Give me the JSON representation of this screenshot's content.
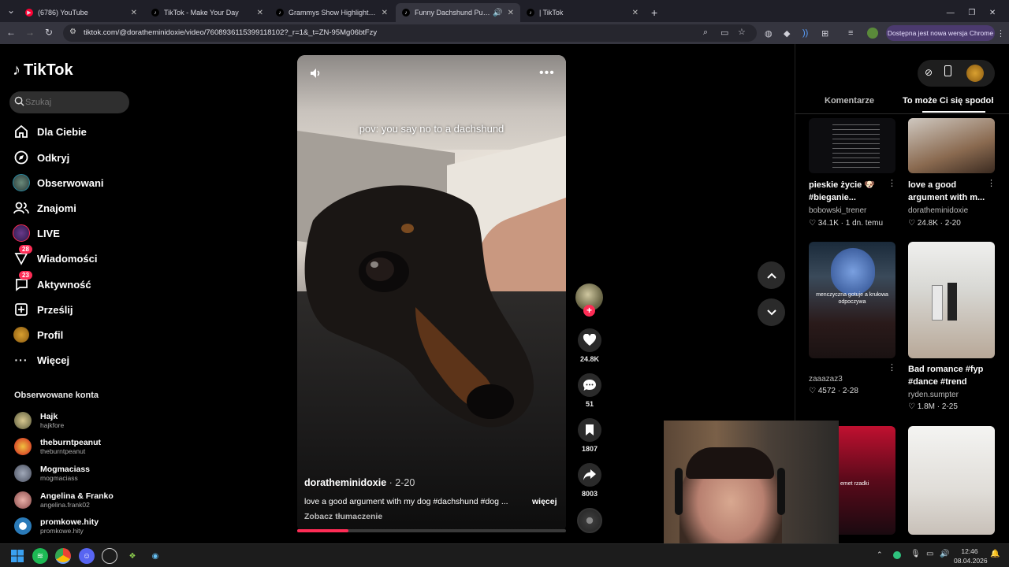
{
  "browser": {
    "tabs": [
      {
        "title": "(6786) YouTube",
        "active": false,
        "favicon": "youtube-icon"
      },
      {
        "title": "TikTok - Make Your Day",
        "active": false,
        "favicon": "tiktok-icon"
      },
      {
        "title": "Grammys Show Highlights | Tik",
        "active": false,
        "favicon": "tiktok-icon"
      },
      {
        "title": "Funny Dachshund Puppy Ar",
        "active": true,
        "favicon": "tiktok-icon"
      },
      {
        "title": "| TikTok",
        "active": false,
        "favicon": "tiktok-icon"
      }
    ],
    "url": "tiktok.com/@doratheminidoxie/video/7608936115399118102?_r=1&_t=ZN-95Mg06btFzy",
    "update_label": "Dostępna jest nowa wersja Chrome"
  },
  "sidebar": {
    "logo": "TikTok",
    "search_placeholder": "Szukaj",
    "items": [
      {
        "label": "Dla Ciebie",
        "icon": "home-icon"
      },
      {
        "label": "Odkryj",
        "icon": "compass-icon"
      },
      {
        "label": "Obserwowani",
        "icon": "avatar-icon"
      },
      {
        "label": "Znajomi",
        "icon": "friends-icon"
      },
      {
        "label": "LIVE",
        "icon": "live-icon"
      },
      {
        "label": "Wiadomości",
        "icon": "messages-icon",
        "badge": "28"
      },
      {
        "label": "Aktywność",
        "icon": "activity-icon",
        "badge": "23"
      },
      {
        "label": "Prześlij",
        "icon": "upload-icon"
      },
      {
        "label": "Profil",
        "icon": "profile-icon"
      },
      {
        "label": "Więcej",
        "icon": "more-icon"
      }
    ],
    "followed_title": "Obserwowane konta",
    "followed": [
      {
        "name": "Hajk",
        "handle": "hajkfore"
      },
      {
        "name": "theburntpeanut",
        "handle": "theburntpeanut"
      },
      {
        "name": "Mogmaciass",
        "handle": "mogmaciass"
      },
      {
        "name": "Angelina & Franko",
        "handle": "angelina.frank02"
      },
      {
        "name": "promkowe.hity",
        "handle": "promkowe.hity"
      }
    ]
  },
  "video": {
    "overlay_text": "pov: you say no to a dachshund",
    "author": "doratheminidoxie",
    "date": "· 2-20",
    "description": "love a good argument with my dog #dachshund #dog ...",
    "more_label": "więcej",
    "translate_label": "Zobacz tłumaczenie",
    "progress_fraction": 0.19
  },
  "actions": {
    "likes": "24.8K",
    "comments": "51",
    "saves": "1807",
    "shares": "8003"
  },
  "right_panel": {
    "tab_comments": "Komentarze",
    "tab_foryou": "To może Ci się spodobać",
    "cards": [
      {
        "title": "pieskie życie 🐶 #bieganie...",
        "user": "bobowski_trener",
        "stats": "♡ 34.1K · 1 dn. temu"
      },
      {
        "title": "love a good argument with m...",
        "user": "doratheminidoxie",
        "stats": "♡ 24.8K · 2-20"
      },
      {
        "title": "",
        "user": "zaaazaz3",
        "stats": "♡ 4572 · 2-28"
      },
      {
        "title": "Bad romance #fyp #dance #trend",
        "user": "ryden.sumpter",
        "stats": "♡ 1.8M · 2-25"
      }
    ],
    "thumb_text_1": "menczyczna gotuje a krułowa odpoczywa",
    "thumb_text_2": "emet rzadki"
  },
  "taskbar": {
    "time": "12:46",
    "date": "08.04.2026"
  },
  "colors": {
    "accent": "#fe2c55",
    "background": "#000000"
  }
}
